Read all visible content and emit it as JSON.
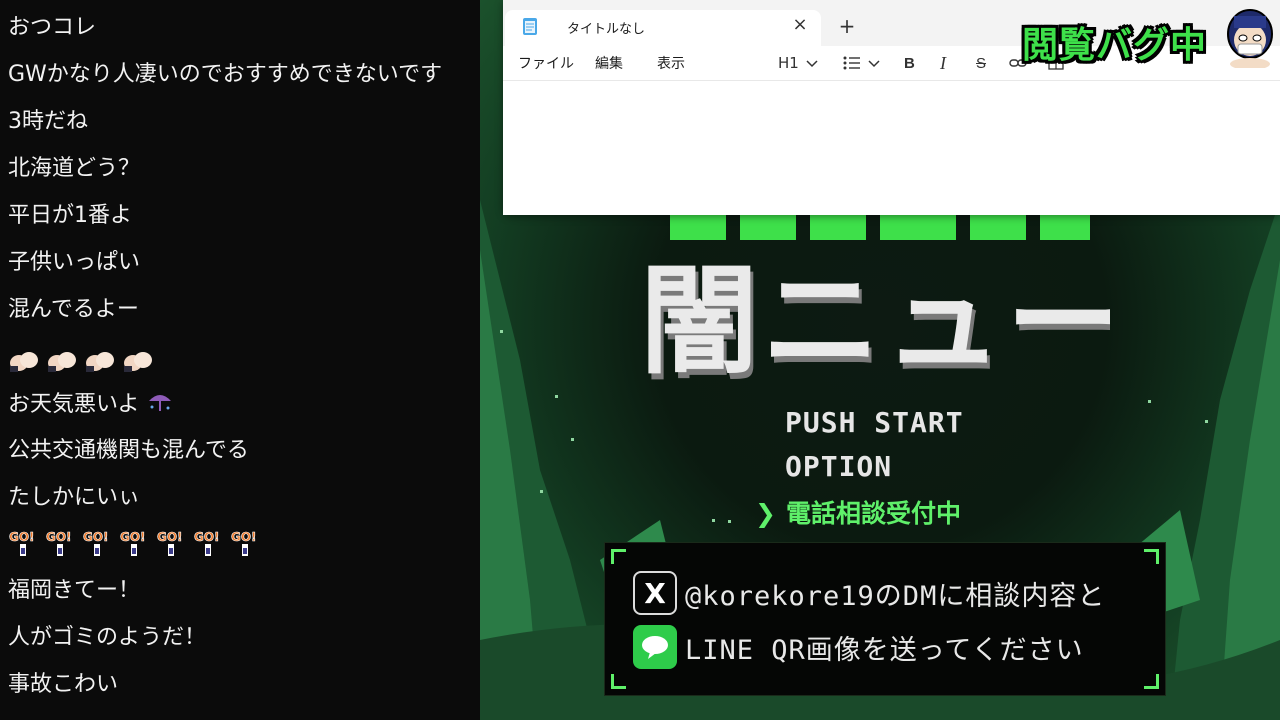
{
  "chat": {
    "messages": [
      "おつコレ",
      "GWかなり人凄いのでおすすめできないです",
      "3時だね",
      "北海道どう？",
      "平日が1番よ",
      "子供いっぱい",
      "混んでるよー",
      "",
      "お天気悪いよ",
      "公共交通機関も混んでる",
      "たしかにいぃ",
      "",
      "福岡きてー！",
      "人がゴミのようだ！",
      "事故こわい"
    ],
    "go_label": "GO!"
  },
  "notepad": {
    "tab_title": "タイトルなし",
    "tab_close": "×",
    "new_tab": "+",
    "menus": [
      "ファイル",
      "編集",
      "表示"
    ],
    "heading_tool": "H1",
    "bold_tool": "B",
    "italic_tool": "I",
    "strike_tool": "S"
  },
  "game": {
    "title": "闇ニュース",
    "menu": [
      "PUSH START",
      "OPTION"
    ],
    "selected_item": "電話相談受付中",
    "selector_glyph": "❯",
    "contact": {
      "x_line": "@korekore19のDMに相談内容と",
      "line_line": "LINE QR画像を送ってください"
    },
    "accent_color": "#5ff06a"
  },
  "badge": {
    "text": "閲覧バグ中"
  }
}
